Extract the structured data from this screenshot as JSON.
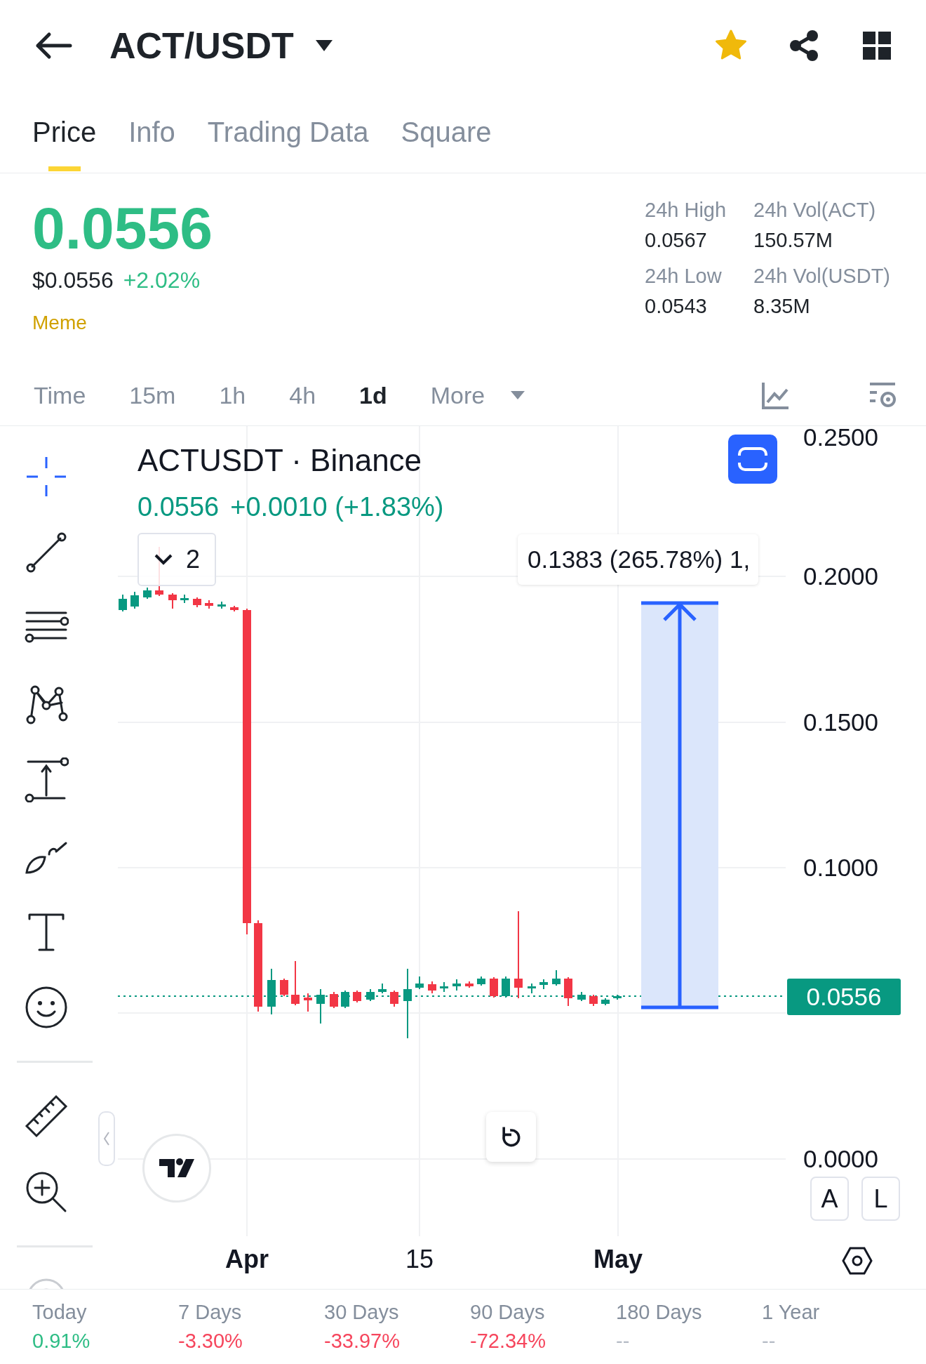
{
  "header": {
    "title": "ACT/USDT",
    "favorite": true
  },
  "tabs": [
    {
      "label": "Price",
      "selected": true
    },
    {
      "label": "Info",
      "selected": false
    },
    {
      "label": "Trading Data",
      "selected": false
    },
    {
      "label": "Square",
      "selected": false
    }
  ],
  "price": {
    "last": "0.0556",
    "fiat": "$0.0556",
    "change": "+2.02%",
    "tag": "Meme"
  },
  "stats": [
    {
      "label": "24h High",
      "value": "0.0567"
    },
    {
      "label": "24h Vol(ACT)",
      "value": "150.57M"
    },
    {
      "label": "24h Low",
      "value": "0.0543"
    },
    {
      "label": "24h Vol(USDT)",
      "value": "8.35M"
    }
  ],
  "intervals": [
    {
      "label": "Time",
      "kind": "interval",
      "selected": false
    },
    {
      "label": "15m",
      "kind": "interval",
      "selected": false
    },
    {
      "label": "1h",
      "kind": "interval",
      "selected": false
    },
    {
      "label": "4h",
      "kind": "interval",
      "selected": false
    },
    {
      "label": "1d",
      "kind": "interval",
      "selected": true
    },
    {
      "label": "More",
      "kind": "dropdown",
      "selected": false
    }
  ],
  "chart": {
    "symbol": "ACTUSDT · Binance",
    "quote_price": "0.0556",
    "quote_change": "+0.0010 (+1.83%)",
    "indicators_count": "2",
    "measure_label": "0.1383 (265.78%) 1,",
    "price_axis": [
      "0.2500",
      "0.2000",
      "0.1500",
      "0.1000",
      "0.0000"
    ],
    "last_price": "0.0556",
    "time_axis": [
      {
        "label": "Apr",
        "bold": true
      },
      {
        "label": "15",
        "bold": false
      },
      {
        "label": "May",
        "bold": true
      }
    ],
    "scale_buttons": [
      "A",
      "L"
    ]
  },
  "periods": [
    {
      "label": "Today",
      "value": "0.91%",
      "color": "#2ebd85"
    },
    {
      "label": "7 Days",
      "value": "-3.30%",
      "color": "#f6465d"
    },
    {
      "label": "30 Days",
      "value": "-33.97%",
      "color": "#f6465d"
    },
    {
      "label": "90 Days",
      "value": "-72.34%",
      "color": "#f6465d"
    },
    {
      "label": "180 Days",
      "value": "--",
      "color": "#b7bdc6"
    },
    {
      "label": "1 Year",
      "value": "--",
      "color": "#b7bdc6"
    }
  ]
}
